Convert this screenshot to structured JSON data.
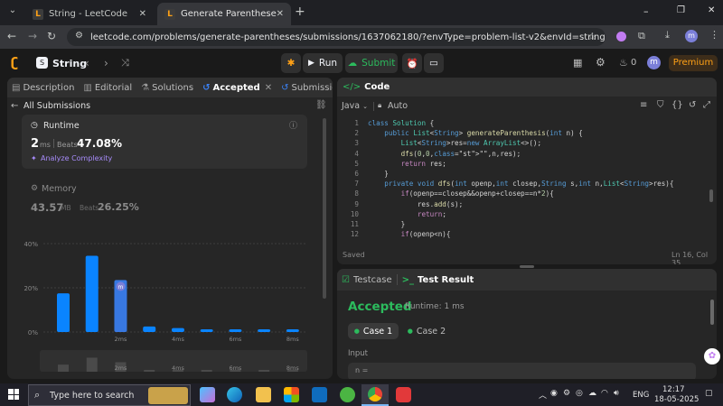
{
  "browser": {
    "tabs": [
      {
        "title": "String - LeetCode",
        "close": "✕"
      },
      {
        "title": "Generate Parentheses - LeetCode",
        "close": "✕"
      }
    ],
    "new_tab": "+",
    "url": "leetcode.com/problems/generate-parentheses/submissions/1637062180/?envType=problem-list-v2&envId=string",
    "profile_initial": "m",
    "window_controls": [
      "–",
      "❐",
      "✕"
    ]
  },
  "header": {
    "list_title": "String",
    "run_label": "Run",
    "submit_label": "Submit",
    "streak_count": "0",
    "avatar": "m",
    "premium_label": "Premium"
  },
  "left_tabs": [
    {
      "label": "Description"
    },
    {
      "label": "Editorial"
    },
    {
      "label": "Solutions"
    },
    {
      "label": "Accepted"
    },
    {
      "label": "Submissions"
    }
  ],
  "all_submissions": "All Submissions",
  "runtime": {
    "label": "Runtime",
    "value": "2",
    "unit": "ms",
    "beats_label": "Beats",
    "beats": "47.08%",
    "analyze": "Analyze Complexity"
  },
  "memory": {
    "label": "Memory",
    "value": "43.57",
    "unit": "MB",
    "beats_label": "Beats",
    "beats": "26.25%"
  },
  "chart_data": {
    "type": "bar",
    "y_ticks": [
      "40%",
      "20%",
      "0%"
    ],
    "ylim": [
      0,
      40
    ],
    "values": [
      17.5,
      34.5,
      23.5,
      2.5,
      1.8,
      1.2,
      1.2,
      1.2,
      1.2
    ],
    "highlight_index": 2,
    "highlight_marker": "m",
    "x_ticks": [
      "2ms",
      "4ms",
      "6ms",
      "8ms"
    ],
    "mini_ticks": [
      "2ms",
      "4ms",
      "6ms",
      "8ms"
    ],
    "colors": {
      "bar": "#0a84ff",
      "highlight": "#3b82f6"
    }
  },
  "editor": {
    "title": "Code",
    "language": "Java",
    "mode": "Auto",
    "status": "Saved",
    "cursor": "Ln 16, Col 35",
    "line_numbers": [
      "1",
      "2",
      "3",
      "4",
      "5",
      "6",
      "7",
      "8",
      "9",
      "10",
      "11",
      "12"
    ],
    "lines": [
      "class Solution {",
      "    public List<String> generateParenthesis(int n) {",
      "        List<String>res=new ArrayList<>();",
      "        dfs(0,0,\"\",n,res);",
      "        return res;",
      "    }",
      "    private void dfs(int openp,int closep,String s,int n,List<String>res){",
      "        if(openp==closep&&openp+closep==n*2){",
      "            res.add(s);",
      "            return;",
      "        }",
      "        if(openp<n){"
    ]
  },
  "testpanel": {
    "testcase_tab": "Testcase",
    "result_tab": "Test Result",
    "status": "Accepted",
    "runtime_text": "Runtime: 1 ms",
    "cases": [
      "Case 1",
      "Case 2"
    ],
    "input_label": "Input",
    "input_value": "n ="
  },
  "taskbar": {
    "search_placeholder": "Type here to search",
    "time": "12:17",
    "date": "18-05-2025",
    "lang": "ENG"
  }
}
